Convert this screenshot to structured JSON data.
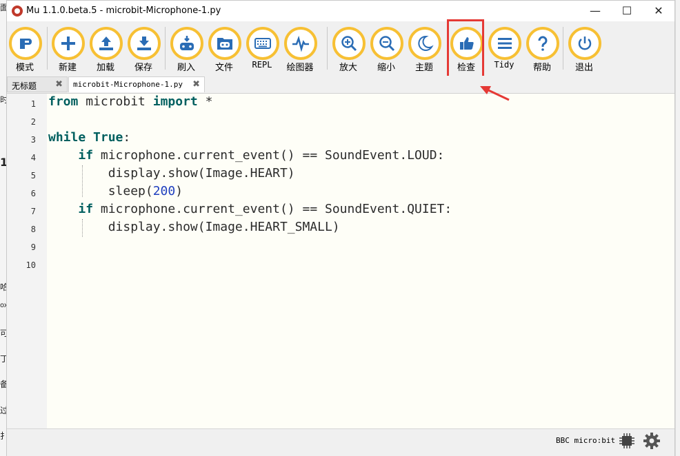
{
  "window": {
    "title": "Mu 1.1.0.beta.5 - microbit-Microphone-1.py",
    "minimize_glyph": "—",
    "maximize_glyph": "☐",
    "close_glyph": "✕"
  },
  "toolbar": {
    "buttons": [
      {
        "label": "模式",
        "icon": "mode-icon"
      },
      {
        "label": "新建",
        "icon": "plus-icon"
      },
      {
        "label": "加载",
        "icon": "upload-icon"
      },
      {
        "label": "保存",
        "icon": "download-icon"
      },
      {
        "label": "刷入",
        "icon": "flash-icon"
      },
      {
        "label": "文件",
        "icon": "files-icon"
      },
      {
        "label": "REPL",
        "icon": "keyboard-icon"
      },
      {
        "label": "绘图器",
        "icon": "plotter-icon"
      },
      {
        "label": "放大",
        "icon": "zoom-in-icon"
      },
      {
        "label": "缩小",
        "icon": "zoom-out-icon"
      },
      {
        "label": "主题",
        "icon": "moon-icon"
      },
      {
        "label": "检查",
        "icon": "thumbs-up-icon"
      },
      {
        "label": "Tidy",
        "icon": "lines-icon"
      },
      {
        "label": "帮助",
        "icon": "question-icon"
      },
      {
        "label": "退出",
        "icon": "power-icon"
      }
    ]
  },
  "tabs": [
    {
      "label": "无标题",
      "close": "✖"
    },
    {
      "label": "microbit-Microphone-1.py",
      "close": "✖"
    }
  ],
  "editor": {
    "line_numbers": [
      "1",
      "2",
      "3",
      "4",
      "5",
      "6",
      "7",
      "8",
      "9",
      "10"
    ]
  },
  "status": {
    "device": "BBC micro:bit"
  },
  "background_window_chars": [
    "面",
    "时",
    "1",
    "哈",
    "ox",
    "可",
    "丁",
    "备",
    "过",
    "扌"
  ],
  "colors": {
    "accent": "#f7c034",
    "highlight": "#e53935",
    "keyword": "#005f5f",
    "number": "#1f3fbf",
    "editor_bg": "#fefef7"
  }
}
